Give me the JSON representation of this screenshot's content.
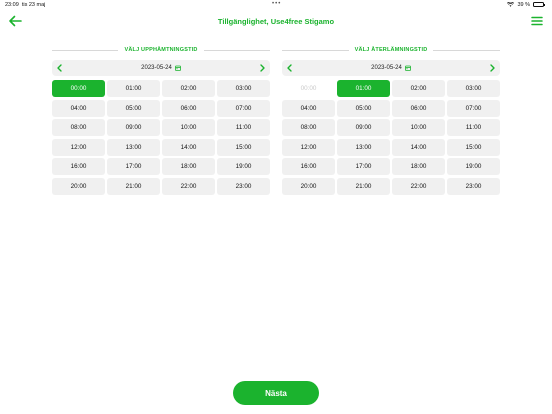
{
  "status_bar": {
    "time": "23:09",
    "date": "tis 23 maj",
    "battery": "39 %",
    "battery_level": 0.39,
    "dots": "•••"
  },
  "header": {
    "title": "Tillgänglighet, Use4free Stigamo"
  },
  "colors": {
    "accent": "#1bb32e",
    "slot_bg": "#f0f0f0"
  },
  "pickup": {
    "heading": "VÄLJ UPPHÄMTNINGSTID",
    "date": "2023-05-24",
    "selected": "00:00",
    "slots": [
      "00:00",
      "01:00",
      "02:00",
      "03:00",
      "04:00",
      "05:00",
      "06:00",
      "07:00",
      "08:00",
      "09:00",
      "10:00",
      "11:00",
      "12:00",
      "13:00",
      "14:00",
      "15:00",
      "16:00",
      "17:00",
      "18:00",
      "19:00",
      "20:00",
      "21:00",
      "22:00",
      "23:00"
    ]
  },
  "return": {
    "heading": "VÄLJ ÅTERLÄMNINGSTID",
    "date": "2023-05-24",
    "selected": "01:00",
    "disabled": [
      "00:00"
    ],
    "slots": [
      "00:00",
      "01:00",
      "02:00",
      "03:00",
      "04:00",
      "05:00",
      "06:00",
      "07:00",
      "08:00",
      "09:00",
      "10:00",
      "11:00",
      "12:00",
      "13:00",
      "14:00",
      "15:00",
      "16:00",
      "17:00",
      "18:00",
      "19:00",
      "20:00",
      "21:00",
      "22:00",
      "23:00"
    ]
  },
  "footer": {
    "next_label": "Nästa"
  }
}
